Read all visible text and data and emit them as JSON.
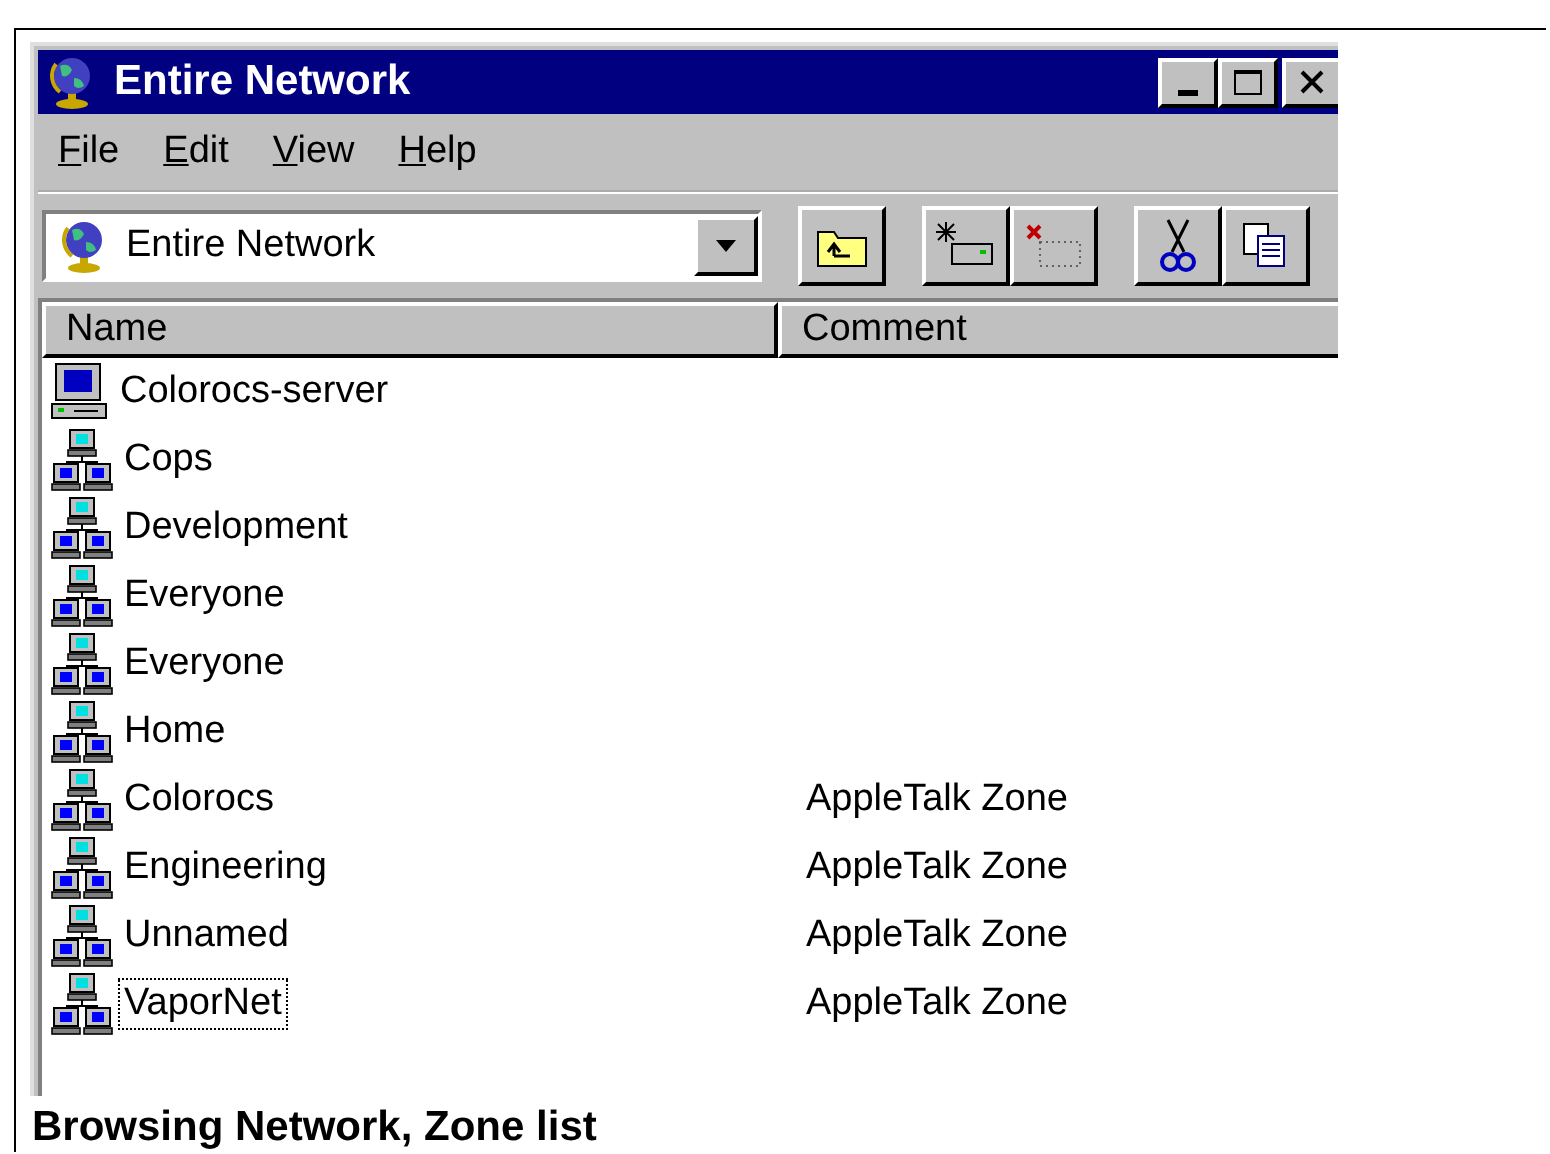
{
  "window": {
    "title": "Entire Network"
  },
  "menu": [
    {
      "accel": "F",
      "rest": "ile"
    },
    {
      "accel": "E",
      "rest": "dit"
    },
    {
      "accel": "V",
      "rest": "iew"
    },
    {
      "accel": "H",
      "rest": "elp"
    }
  ],
  "address": {
    "value": "Entire Network"
  },
  "toolbar": [
    {
      "kind": "up-folder"
    },
    {
      "kind": "map-drive"
    },
    {
      "kind": "disconnect"
    },
    {
      "kind": "cut"
    },
    {
      "kind": "copy"
    }
  ],
  "columns": [
    "Name",
    "Comment"
  ],
  "rows": [
    {
      "kind": "computer",
      "name": "Colorocs-server",
      "focused": false
    },
    {
      "kind": "zone",
      "name": "Cops",
      "focused": false
    },
    {
      "kind": "zone",
      "name": "Development",
      "focused": false
    },
    {
      "kind": "zone",
      "name": "Everyone",
      "focused": false
    },
    {
      "kind": "zone",
      "name": "Everyone",
      "focused": false
    },
    {
      "kind": "zone",
      "name": "Home",
      "focused": false
    },
    {
      "kind": "zone",
      "name": "Colorocs",
      "comment": "AppleTalk Zone",
      "focused": false
    },
    {
      "kind": "zone",
      "name": "Engineering",
      "comment": "AppleTalk Zone",
      "focused": false
    },
    {
      "kind": "zone",
      "name": "Unnamed",
      "comment": "AppleTalk Zone",
      "focused": false
    },
    {
      "kind": "zone",
      "name": "VaporNet",
      "comment": "AppleTalk Zone",
      "focused": true
    }
  ],
  "caption": "Browsing Network, Zone list"
}
